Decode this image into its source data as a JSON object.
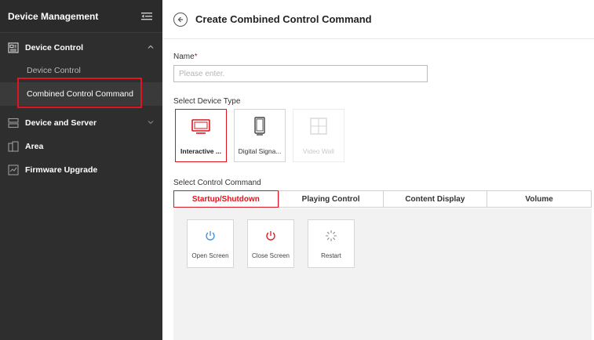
{
  "sidebar": {
    "title": "Device Management",
    "groups": [
      {
        "label": "Device Control",
        "items": [
          "Device Control",
          "Combined Control Command"
        ]
      },
      {
        "label": "Device and Server"
      },
      {
        "label": "Area"
      },
      {
        "label": "Firmware Upgrade"
      }
    ]
  },
  "header": {
    "title": "Create Combined Control Command"
  },
  "form": {
    "name_label": "Name",
    "required_mark": "*",
    "name_placeholder": "Please enter.",
    "device_type_label": "Select Device Type",
    "device_types": [
      "Interactive ...",
      "Digital Signa...",
      "Video Wall"
    ],
    "control_label": "Select Control Command",
    "tabs": [
      "Startup/Shutdown",
      "Playing Control",
      "Content Display",
      "Volume"
    ],
    "commands": [
      "Open Screen",
      "Close Screen",
      "Restart"
    ]
  },
  "colors": {
    "accent": "#e0141e",
    "sidebar_bg": "#2e2e2e",
    "open_icon": "#3a8ee6",
    "close_icon": "#e0141e"
  },
  "icons": {
    "back": "arrow-left-circle-icon",
    "collapse": "menu-collapse-icon",
    "open_screen": "power-icon",
    "close_screen": "power-icon",
    "restart": "spinner-icon"
  }
}
